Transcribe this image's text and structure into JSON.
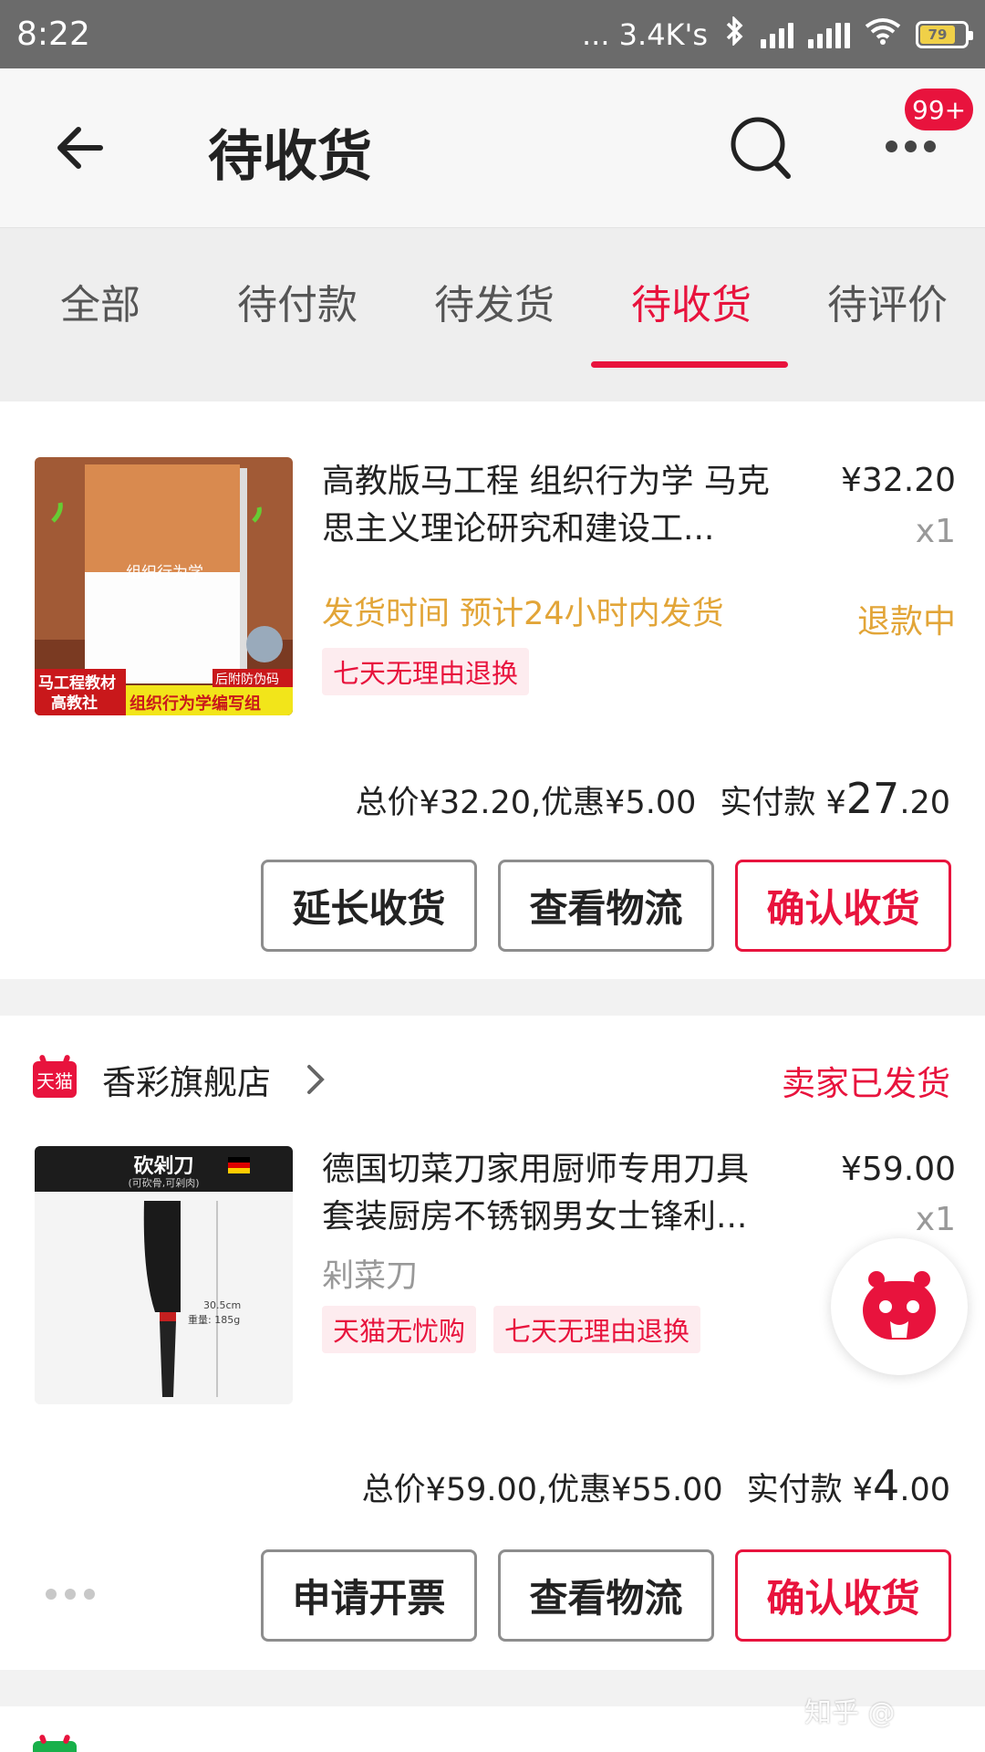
{
  "status_bar": {
    "time": "8:22",
    "network_speed": "... 3.4K's",
    "battery": "79"
  },
  "header": {
    "title": "待收货",
    "badge": "99+",
    "back_icon": "arrow-left-icon",
    "search_icon": "search-icon",
    "more_icon": "more-dots-icon"
  },
  "tabs": [
    {
      "label": "全部"
    },
    {
      "label": "待付款"
    },
    {
      "label": "待发货"
    },
    {
      "label": "待收货",
      "active": true
    },
    {
      "label": "待评价"
    }
  ],
  "orders": [
    {
      "thumb": {
        "center_text": "组织行为学",
        "badge_left_1": "马工程教材",
        "badge_left_2": "高教社",
        "badge_right_top": "后附防伪码",
        "badge_right_bottom": "组织行为学编写组"
      },
      "title": "高教版马工程 组织行为学 马克思主义理论研究和建设工...",
      "price": "¥32.20",
      "qty": "x1",
      "ship_time": "发货时间 预计24小时内发货",
      "refund_status": "退款中",
      "tags": [
        "七天无理由退换"
      ],
      "total_prefix": "总价¥32.20,优惠¥5.00",
      "paid_label": "实付款 ¥",
      "paid_int": "27",
      "paid_dec": ".20",
      "buttons": {
        "extend": "延长收货",
        "logistics": "查看物流",
        "confirm": "确认收货"
      }
    },
    {
      "shop_badge": "天猫",
      "shop_name": "香彩旗舰店",
      "status": "卖家已发货",
      "thumb": {
        "header": "砍剁刀",
        "sub": "(可砍骨,可剁肉)",
        "size": "30.5cm",
        "weight": "重量: 185g"
      },
      "title": "德国切菜刀家用厨师专用刀具套装厨房不锈钢男女士锋利...",
      "price": "¥59.00",
      "qty": "x1",
      "spec": "剁菜刀",
      "tags": [
        "天猫无忧购",
        "七天无理由退换"
      ],
      "total_prefix": "总价¥59.00,优惠¥55.00",
      "paid_label": "实付款 ¥",
      "paid_int": "4",
      "paid_dec": ".00",
      "buttons": {
        "invoice": "申请开票",
        "logistics": "查看物流",
        "confirm": "确认收货"
      }
    }
  ],
  "watermark": "知乎 @",
  "colors": {
    "accent": "#e8133d",
    "warning": "#e2a538",
    "tag_bg": "#fdecef"
  }
}
